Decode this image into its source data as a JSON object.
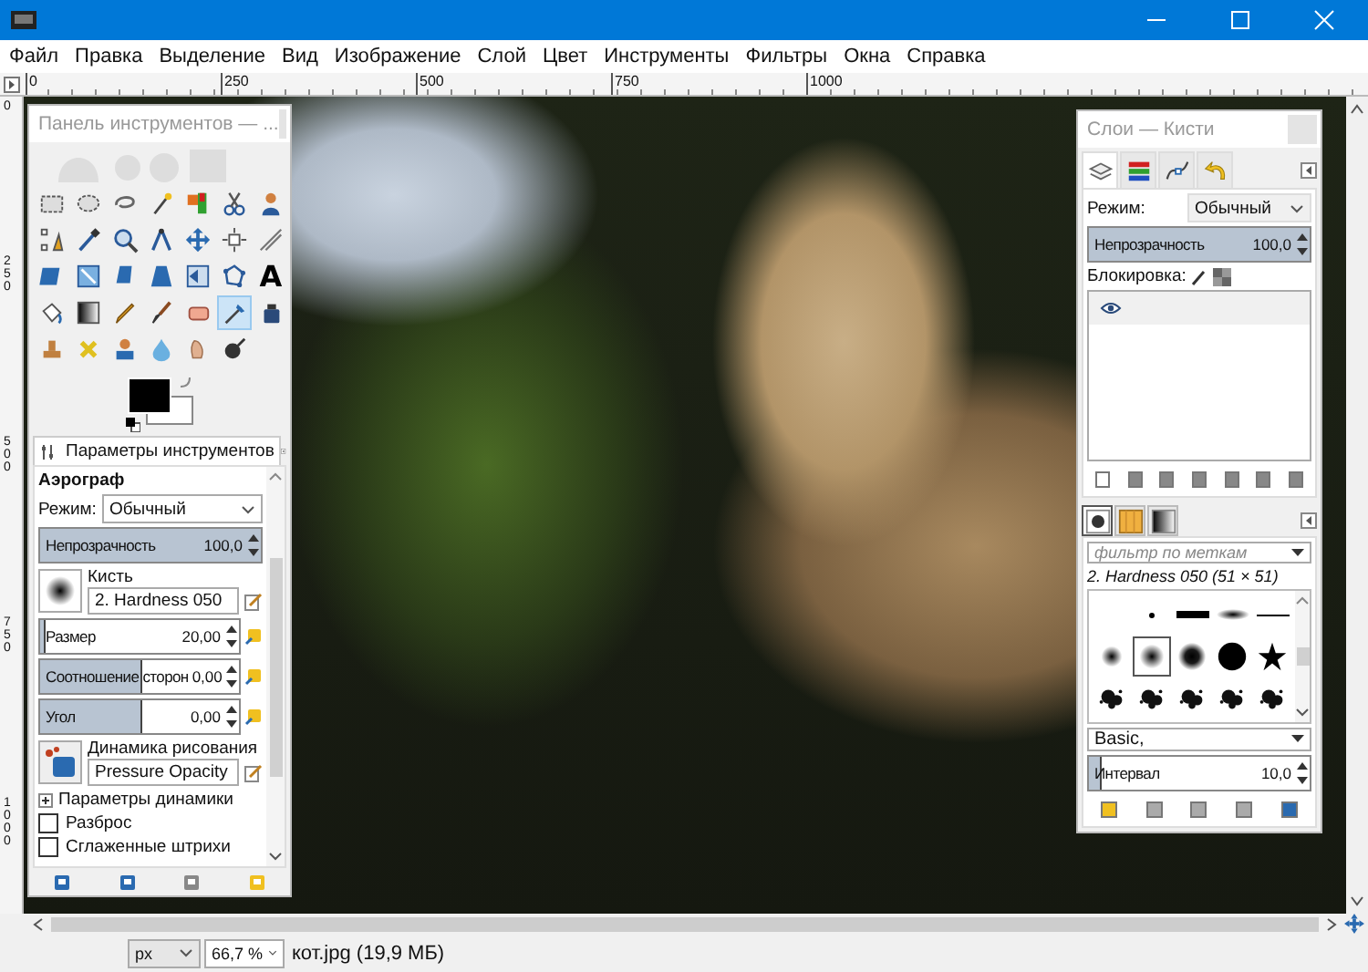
{
  "menu": [
    "Файл",
    "Правка",
    "Выделение",
    "Вид",
    "Изображение",
    "Слой",
    "Цвет",
    "Инструменты",
    "Фильтры",
    "Окна",
    "Справка"
  ],
  "rulers": {
    "horizontal": [
      "0",
      "250",
      "500",
      "750",
      "1000"
    ],
    "vertical": [
      "0",
      "250",
      "500",
      "750",
      "1000"
    ]
  },
  "toolbox": {
    "title": "Панель инструментов — ...",
    "tools": [
      {
        "kind": "rect-select",
        "selected": false
      },
      {
        "kind": "ellipse-select",
        "selected": false
      },
      {
        "kind": "lasso",
        "selected": false
      },
      {
        "kind": "wand",
        "selected": false
      },
      {
        "kind": "color-select",
        "selected": false
      },
      {
        "kind": "scissors",
        "selected": false
      },
      {
        "kind": "foreground-select",
        "selected": false
      },
      {
        "kind": "paths",
        "selected": false
      },
      {
        "kind": "color-picker",
        "selected": false
      },
      {
        "kind": "zoom",
        "selected": false
      },
      {
        "kind": "measure",
        "selected": false
      },
      {
        "kind": "move",
        "selected": false
      },
      {
        "kind": "align",
        "selected": false
      },
      {
        "kind": "crop",
        "selected": false
      },
      {
        "kind": "transform",
        "selected": false
      },
      {
        "kind": "rotate",
        "selected": false
      },
      {
        "kind": "shear",
        "selected": false
      },
      {
        "kind": "perspective",
        "selected": false
      },
      {
        "kind": "flip",
        "selected": false
      },
      {
        "kind": "cage",
        "selected": false
      },
      {
        "kind": "text",
        "glyph": "A",
        "selected": false
      },
      {
        "kind": "bucket",
        "selected": false
      },
      {
        "kind": "gradient",
        "selected": false
      },
      {
        "kind": "pencil",
        "selected": false
      },
      {
        "kind": "paintbrush",
        "selected": false
      },
      {
        "kind": "eraser",
        "selected": false
      },
      {
        "kind": "airbrush",
        "selected": true
      },
      {
        "kind": "ink",
        "selected": false
      },
      {
        "kind": "clone",
        "selected": false
      },
      {
        "kind": "heal",
        "selected": false
      },
      {
        "kind": "perspective-clone",
        "selected": false
      },
      {
        "kind": "blur",
        "selected": false
      },
      {
        "kind": "smudge",
        "selected": false
      },
      {
        "kind": "dodge",
        "selected": false
      }
    ]
  },
  "tool_options": {
    "tab": "Параметры инструментов",
    "tool": "Аэрограф",
    "mode_label": "Режим:",
    "mode": "Обычный",
    "opacity": {
      "label": "Непрозрачность",
      "value": "100,0",
      "level": 1
    },
    "brush_label": "Кисть",
    "brush": "2. Hardness 050",
    "size": {
      "label": "Размер",
      "value": "20,00",
      "level": 0.02
    },
    "aspect": {
      "label": "Соотношение сторон",
      "value": "0,00",
      "level": 0.5
    },
    "angle": {
      "label": "Угол",
      "value": "0,00",
      "level": 0.5
    },
    "dynamics_label": "Динамика рисования",
    "dynamics": "Pressure Opacity",
    "dynamics_options": {
      "label": "Параметры динамики",
      "expanded": false
    },
    "checkboxes": [
      {
        "label": "Разброс",
        "checked": false
      },
      {
        "label": "Сглаженные штрихи",
        "checked": false
      }
    ]
  },
  "layers_dock": {
    "title": "Слои — Кисти",
    "tabs": [
      {
        "kind": "layers",
        "selected": true
      },
      {
        "kind": "channels",
        "selected": false
      },
      {
        "kind": "paths",
        "selected": false
      },
      {
        "kind": "undo",
        "selected": false
      }
    ],
    "mode_label": "Режим:",
    "mode": "Обычный",
    "opacity": {
      "label": "Непрозрачность",
      "value": "100,0",
      "level": 1
    },
    "lock_label": "Блокировка:",
    "layers": [
      {
        "visible": true
      }
    ]
  },
  "brushes_dock": {
    "tabs": [
      {
        "kind": "brushes",
        "selected": true
      },
      {
        "kind": "patterns",
        "selected": false
      },
      {
        "kind": "gradients",
        "selected": false
      }
    ],
    "filter_placeholder": "фильтр по меткам",
    "brush_name": "2. Hardness 050 (51 × 51)",
    "brushes": [
      {
        "kind": "dot",
        "selected": false
      },
      {
        "kind": "bar",
        "selected": false
      },
      {
        "kind": "ellipse",
        "selected": false
      },
      {
        "kind": "line",
        "selected": false
      },
      {
        "kind": "fuzzy-small",
        "selected": false
      },
      {
        "kind": "fuzzy-medium",
        "selected": true
      },
      {
        "kind": "fuzzy-large",
        "selected": false
      },
      {
        "kind": "circle",
        "selected": false
      },
      {
        "kind": "star",
        "selected": false
      },
      {
        "kind": "splatter",
        "selected": false
      },
      {
        "kind": "splatter",
        "selected": false
      },
      {
        "kind": "splatter",
        "selected": false
      },
      {
        "kind": "splatter",
        "selected": false
      },
      {
        "kind": "splatter",
        "selected": false
      }
    ],
    "tag": "Basic,",
    "spacing": {
      "label": "Интервал",
      "value": "10,0",
      "level": 0.05
    }
  },
  "status_bar": {
    "unit": "px",
    "zoom": "66,7 %",
    "file": "кот.jpg (19,9 МБ)"
  }
}
